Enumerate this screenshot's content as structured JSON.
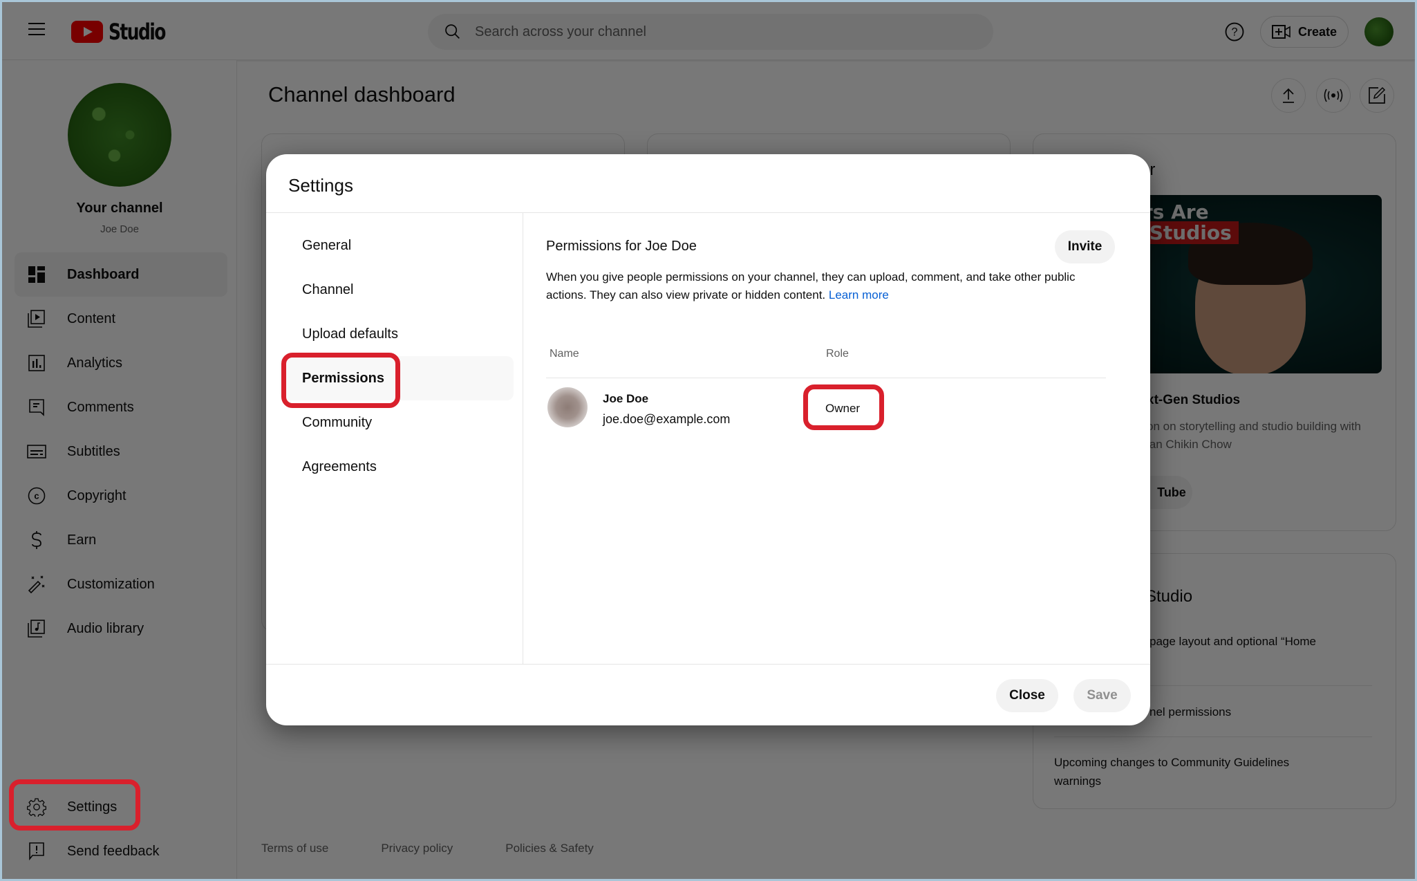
{
  "topbar": {
    "app_name": "Studio",
    "search_placeholder": "Search across your channel",
    "create_label": "Create"
  },
  "sidebar": {
    "channel_title": "Your channel",
    "channel_handle": "Joe Doe",
    "items": [
      {
        "label": "Dashboard",
        "icon": "dashboard-icon",
        "active": true
      },
      {
        "label": "Content",
        "icon": "content-icon"
      },
      {
        "label": "Analytics",
        "icon": "analytics-icon"
      },
      {
        "label": "Comments",
        "icon": "comments-icon"
      },
      {
        "label": "Subtitles",
        "icon": "subtitles-icon"
      },
      {
        "label": "Copyright",
        "icon": "copyright-icon"
      },
      {
        "label": "Earn",
        "icon": "dollar-icon"
      },
      {
        "label": "Customization",
        "icon": "magic-wand-icon"
      },
      {
        "label": "Audio library",
        "icon": "audio-library-icon"
      }
    ],
    "bottom_items": [
      {
        "label": "Settings",
        "icon": "gear-icon"
      },
      {
        "label": "Send feedback",
        "icon": "feedback-icon"
      }
    ]
  },
  "main": {
    "title": "Channel dashboard",
    "creator_card": {
      "title_fragment": "er",
      "thumb_line1": "Creators Are",
      "thumb_line2": "ext-Gen Studios",
      "video_title_fragment": "xt-Gen Studios",
      "desc_line1": "on on storytelling and studio building with",
      "desc_line2": "lan Chikin Chow",
      "button_fragment": "Tube"
    },
    "news_card": {
      "title_fragment": "Studio",
      "items": [
        "page layout and optional “Home",
        "nel permissions",
        "Upcoming changes to Community Guidelines warnings"
      ]
    },
    "footer_links": [
      "Terms of use",
      "Privacy policy",
      "Policies & Safety"
    ]
  },
  "modal": {
    "title": "Settings",
    "nav": [
      "General",
      "Channel",
      "Upload defaults",
      "Permissions",
      "Community",
      "Agreements"
    ],
    "active_nav": "Permissions",
    "permissions_title": "Permissions for Joe Doe",
    "invite_label": "Invite",
    "description": "When you give people permissions on your channel, they can upload, comment, and take other public actions. They can also view private or hidden content.",
    "learn_more": "Learn more",
    "columns": {
      "name": "Name",
      "role": "Role"
    },
    "rows": [
      {
        "name": "Joe Doe",
        "email": "joe.doe@example.com",
        "role": "Owner"
      }
    ],
    "close_label": "Close",
    "save_label": "Save"
  },
  "colors": {
    "brand_red": "#ff0000",
    "highlight_red": "#d9202c",
    "link_blue": "#065fd4",
    "overlay": "rgba(0,0,0,0.53)"
  }
}
